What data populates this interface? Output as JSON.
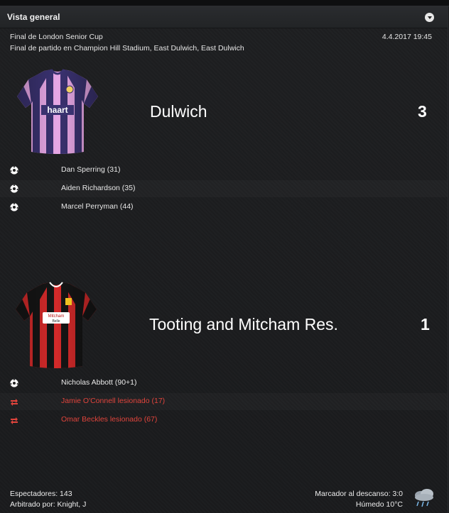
{
  "header": {
    "title": "Vista general"
  },
  "match": {
    "competition": "Final de London Senior Cup",
    "venue": "Final de partido en Champion Hill Stadium, East Dulwich, East Dulwich",
    "datetime": "4.4.2017 19:45"
  },
  "home": {
    "name": "Dulwich",
    "score": "3",
    "kit_sponsor": "haart",
    "colors": {
      "primary": "#e7a7e6",
      "secondary": "#3a3270"
    },
    "events": [
      {
        "type": "goal",
        "icon": "football-icon",
        "text": "Dan Sperring (31)"
      },
      {
        "type": "goal",
        "icon": "football-icon",
        "text": "Aiden Richardson (35)"
      },
      {
        "type": "goal",
        "icon": "football-icon",
        "text": "Marcel Perryman (44)"
      }
    ]
  },
  "away": {
    "name": "Tooting and Mitcham Res.",
    "score": "1",
    "kit_sponsor": "Mitcham Belle",
    "colors": {
      "primary": "#d42a2a",
      "secondary": "#151515"
    },
    "events": [
      {
        "type": "goal",
        "icon": "football-icon",
        "text": "Nicholas Abbott (90+1)"
      },
      {
        "type": "injury",
        "icon": "injury-substitution-icon",
        "text": "Jamie O'Connell lesionado (17)"
      },
      {
        "type": "injury",
        "icon": "injury-substitution-icon",
        "text": "Omar Beckles lesionado (67)"
      }
    ]
  },
  "footer": {
    "attendance": "Espectadores: 143",
    "referee": "Arbitrado por: Knight, J",
    "halftime": "Marcador al descanso: 3:0",
    "weather": "Húmedo 10°C",
    "weather_icon": "rain-cloud-icon"
  },
  "colors": {
    "injury_text": "#e0443c",
    "background": "#1b1c1e"
  }
}
